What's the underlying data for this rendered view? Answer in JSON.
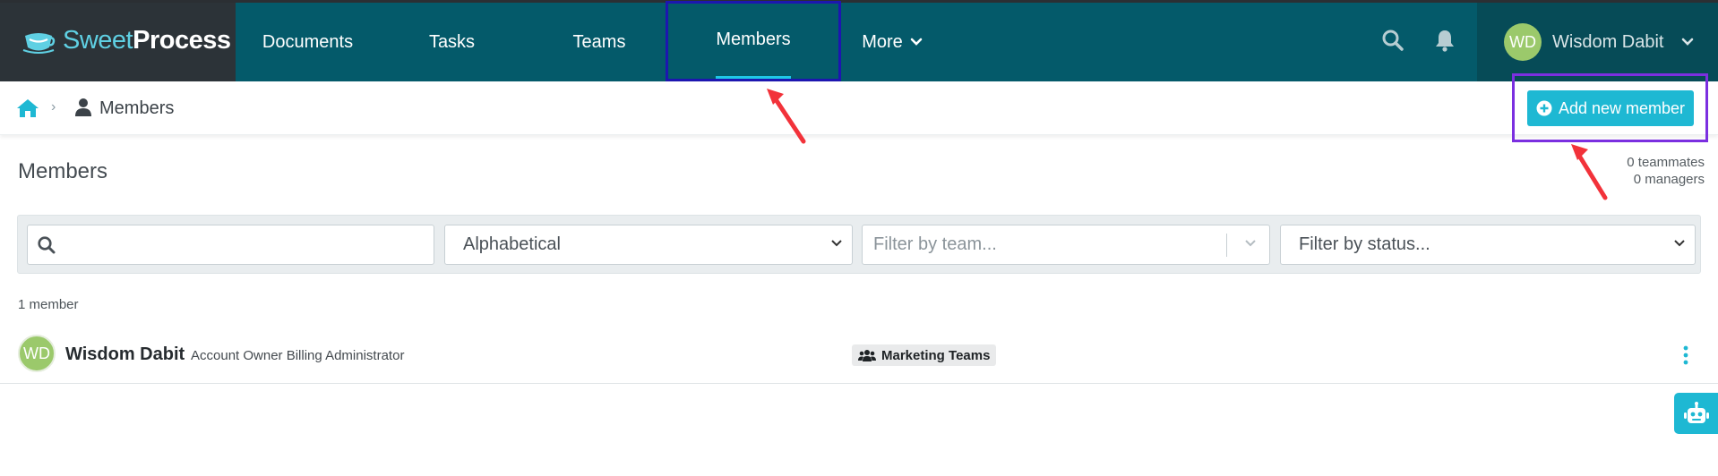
{
  "brand": {
    "name_light": "Sweet",
    "name_bold": "Process"
  },
  "nav": {
    "items": [
      {
        "label": "Documents"
      },
      {
        "label": "Tasks"
      },
      {
        "label": "Teams"
      },
      {
        "label": "Members",
        "active": true
      },
      {
        "label": "More"
      }
    ],
    "user": {
      "initials": "WD",
      "name": "Wisdom Dabit"
    }
  },
  "breadcrumb": {
    "current": "Members"
  },
  "actions": {
    "add_member_label": "Add new member"
  },
  "page": {
    "title": "Members",
    "teammates_count": "0 teammates",
    "managers_count": "0 managers"
  },
  "filters": {
    "search_value": "",
    "sort_selected": "Alphabetical",
    "team_placeholder": "Filter by team...",
    "status_placeholder": "Filter by status..."
  },
  "members": {
    "count_label": "1 member",
    "rows": [
      {
        "initials": "WD",
        "name": "Wisdom Dabit",
        "roles": "Account Owner Billing Administrator",
        "team": "Marketing Teams"
      }
    ]
  },
  "colors": {
    "nav_bg": "#045a6a",
    "logo_bg": "#2c3338",
    "accent": "#1eb8d3",
    "avatar": "#9bc96b",
    "annotation_arrow": "#f2323a",
    "highlight_nav": "#1d16b0",
    "highlight_button": "#7b2fe0"
  }
}
